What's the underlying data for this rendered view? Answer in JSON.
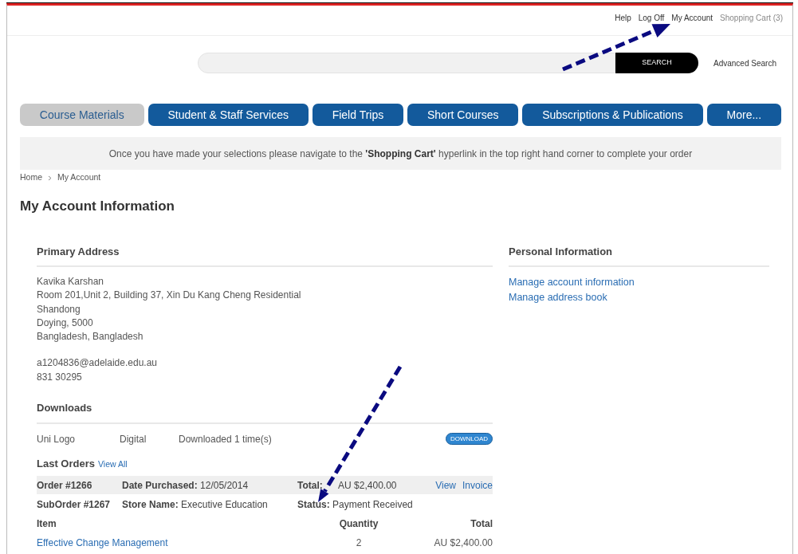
{
  "top_links": [
    {
      "label": "Help"
    },
    {
      "label": "Log Off"
    },
    {
      "label": "My Account"
    },
    {
      "label": "Shopping Cart (3)"
    }
  ],
  "search": {
    "button": "SEARCH",
    "advanced": "Advanced Search"
  },
  "tabs": [
    {
      "label": "Course Materials",
      "selected": true
    },
    {
      "label": "Student & Staff Services",
      "selected": false
    },
    {
      "label": "Field Trips",
      "selected": false
    },
    {
      "label": "Short Courses",
      "selected": false
    },
    {
      "label": "Subscriptions & Publications",
      "selected": false
    },
    {
      "label": "More...",
      "selected": false
    }
  ],
  "notice": "Once you have made your selections please navigate to the **'Shopping Cart'** hyperlink in the top right hand corner to complete your order",
  "breadcrumb": [
    "Home",
    "My Account"
  ],
  "page_title": "My Account Information",
  "primary_address": {
    "heading": "Primary Address",
    "lines": [
      "Kavika Karshan",
      "Room 201,Unit 2, Building 37, Xin Du Kang Cheng Residential",
      "Shandong",
      "Doying, 5000",
      "Bangladesh, Bangladesh"
    ],
    "email": "a1204836@adelaide.edu.au",
    "phone": "831 30295"
  },
  "personal_information": {
    "heading": "Personal Information",
    "links": [
      "Manage account information",
      "Manage address book"
    ]
  },
  "downloads": {
    "heading": "Downloads",
    "rows": [
      {
        "name": "Uni Logo",
        "type": "Digital",
        "count": "Downloaded 1 time(s)",
        "button": "DOWNLOAD"
      }
    ]
  },
  "last_orders": {
    "heading": "Last Orders",
    "view_all": "View All",
    "order": {
      "number": "Order #1266",
      "date_label": "Date Purchased:",
      "date": "12/05/2014",
      "total_label": "Total:",
      "total": "AU $2,400.00",
      "links": [
        "View",
        "Invoice"
      ]
    },
    "suborder": {
      "number": "SubOrder #1267",
      "store_label": "Store Name:",
      "store": "Executive Education",
      "status_label": "Status:",
      "status": "Payment Received"
    },
    "columns": [
      "Item",
      "Quantity",
      "Total"
    ],
    "items": [
      {
        "item": "Effective Change Management",
        "quantity": "2",
        "total": "AU $2,400.00"
      }
    ]
  }
}
